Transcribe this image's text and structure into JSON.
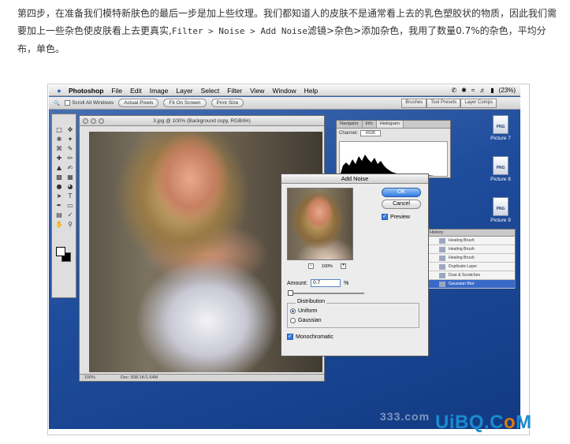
{
  "article": {
    "paragraph_part1": "第四步，在准备我们模特新肤色的最后一步是加上些纹理。我们都知道人的皮肤不是通常看上去的乳色塑胶状的物质，因此我们需要加上一些杂色使皮肤看上去更真实,",
    "menu_path": "Filter > Noise > Add Noise",
    "paragraph_part2": "滤镜>杂色>添加杂色，我用了数量0.7%的杂色，平均分布，单色。"
  },
  "menubar": {
    "items": [
      "Photoshop",
      "File",
      "Edit",
      "Image",
      "Layer",
      "Select",
      "Filter",
      "View",
      "Window",
      "Help"
    ],
    "battery": "(23%)"
  },
  "optionsbar": {
    "scroll_all": "Scroll All Windows",
    "actual_pixels": "Actual Pixels",
    "fit_on_screen": "Fit On Screen",
    "print_size": "Print Size",
    "palette_tabs": [
      "Brushes",
      "Tool Presets",
      "Layer Comps"
    ]
  },
  "document": {
    "title": "3.jpg @ 100% (Background copy, RGB/8#)",
    "zoom": "100%",
    "doc_info": "Doc: 838.1K/1.64M"
  },
  "navigator": {
    "tabs": [
      "Navigator",
      "Info",
      "Histogram"
    ],
    "channel_label": "Channel:",
    "channel_value": "RGB"
  },
  "desktop_icons": [
    "Picture 7",
    "Picture 8",
    "Picture 9"
  ],
  "history": {
    "tab": "History",
    "items": [
      "Healing Brush",
      "Healing Brush",
      "Healing Brush",
      "Duplicate Layer",
      "Dust & Scratches",
      "Gaussian Blur"
    ],
    "selected_index": 5
  },
  "dialog": {
    "title": "Add Noise",
    "ok": "OK",
    "cancel": "Cancel",
    "preview": "Preview",
    "zoom": "100%",
    "amount_label": "Amount:",
    "amount_value": "0.7",
    "amount_unit": "%",
    "amount_slider_fraction": 0.02,
    "distribution_label": "Distribution",
    "uniform": "Uniform",
    "gaussian": "Gaussian",
    "monochromatic": "Monochromatic"
  },
  "watermark": {
    "site1": "333.com",
    "logo_part1": "UiBQ.C",
    "logo_o": "o",
    "logo_part2": "M"
  }
}
